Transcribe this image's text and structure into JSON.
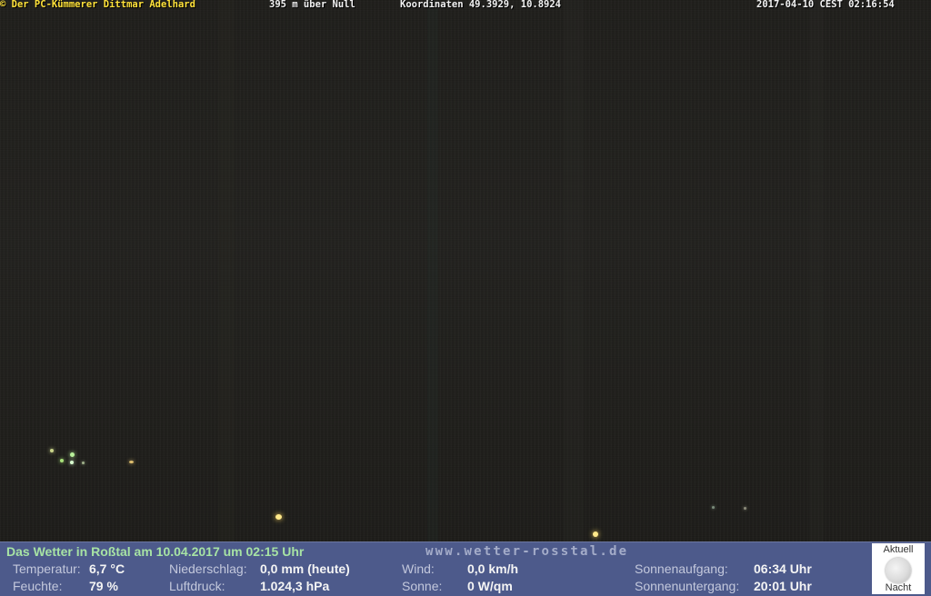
{
  "overlay": {
    "copyright": "© Der PC-Kümmerer Dittmar Adelhard",
    "altitude": "395 m über Null",
    "coordinates": "Koordinaten 49.3929, 10.8924",
    "timestamp": "2017-04-10 CEST 02:16:54"
  },
  "weather": {
    "title": "Das Wetter in Roßtal am 10.04.2017 um 02:15 Uhr",
    "website": "www.wetter-rosstal.de",
    "temperature_label": "Temperatur:",
    "temperature_value": "6,7 °C",
    "humidity_label": "Feuchte:",
    "humidity_value": "79 %",
    "precipitation_label": "Niederschlag:",
    "precipitation_value": "0,0 mm (heute)",
    "pressure_label": "Luftdruck:",
    "pressure_value": "1.024,3 hPa",
    "wind_label": "Wind:",
    "wind_value": "0,0 km/h",
    "sun_label": "Sonne:",
    "sun_value": "0 W/qm",
    "sunrise_label": "Sonnenaufgang:",
    "sunrise_value": "06:34 Uhr",
    "sunset_label": "Sonnenuntergang:",
    "sunset_value": "20:01 Uhr"
  },
  "moon": {
    "top_label": "Aktuell",
    "bottom_label": "Nacht",
    "icon": "moon-icon"
  },
  "colors": {
    "weather_bar": "#4d5a8b",
    "title_green": "#a7e3a4",
    "copyright_yellow": "#ffe23a"
  }
}
